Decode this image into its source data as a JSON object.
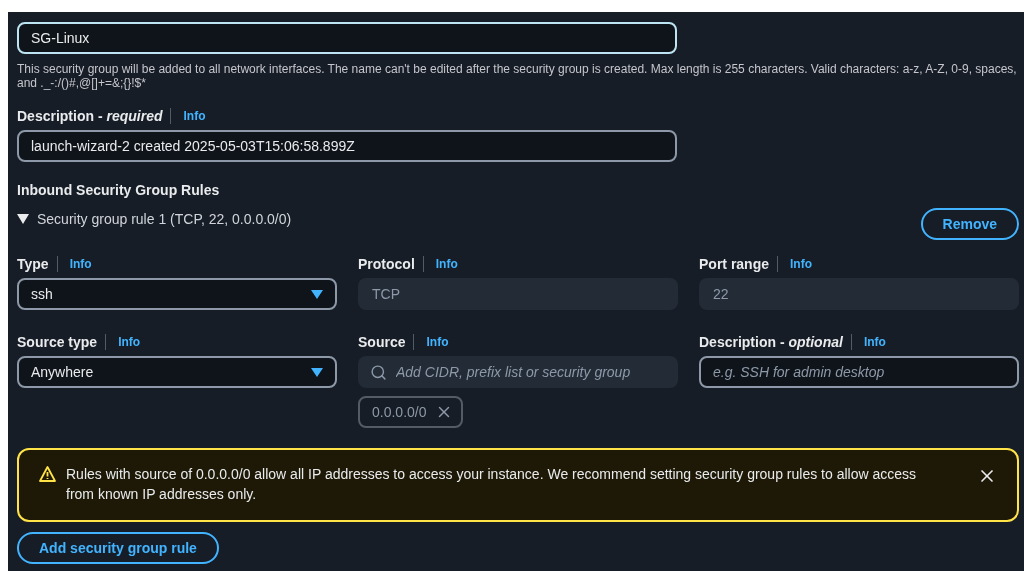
{
  "name_field": {
    "value": "SG-Linux",
    "focused": true
  },
  "name_hint": "This security group will be added to all network interfaces. The name can't be edited after the security group is created. Max length is 255 characters. Valid characters: a-z, A-Z, 0-9, spaces, and ._-:/()#,@[]+=&;{}!$*",
  "description": {
    "label": "Description - *required*",
    "info": "Info",
    "value": "launch-wizard-2 created 2025-05-03T15:06:58.899Z"
  },
  "inbound": {
    "title": "Inbound Security Group Rules",
    "rule": {
      "summary": "Security group rule 1 (TCP, 22, 0.0.0.0/0)",
      "expanded": true,
      "remove_button": "Remove",
      "fields": [
        {
          "kind": "select",
          "label": "Type",
          "info": "Info",
          "value": "ssh"
        },
        {
          "kind": "readonly",
          "label": "Protocol",
          "info": "Info",
          "value": "TCP"
        },
        {
          "kind": "readonly",
          "label": "Port range",
          "info": "Info",
          "value": "22"
        },
        {
          "kind": "select",
          "label": "Source type",
          "info": "Info",
          "value": "Anywhere"
        },
        {
          "kind": "search",
          "label": "Source",
          "info": "Info",
          "placeholder": "Add CIDR, prefix list or security group",
          "tokens": [
            "0.0.0.0/0"
          ]
        },
        {
          "kind": "text",
          "label": "Description - *optional*",
          "info": "Info",
          "placeholder": "e.g. SSH for admin desktop"
        }
      ]
    }
  },
  "alert": {
    "kind": "warning",
    "text": "Rules with source of 0.0.0.0/0 allow all IP addresses to access your instance. We recommend setting security group rules to allow access from known IP addresses only."
  },
  "add_button": "Add security group rule"
}
